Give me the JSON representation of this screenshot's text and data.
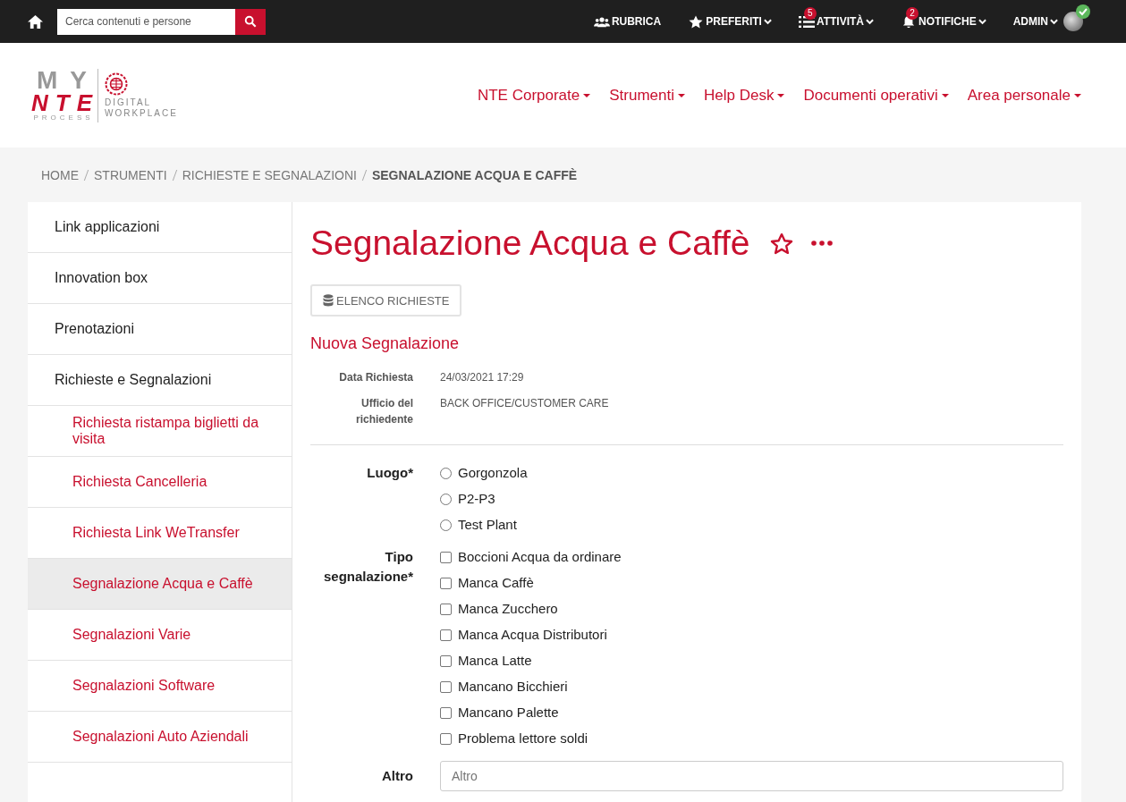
{
  "topbar": {
    "search": {
      "placeholder": "Cerca contenuti e persone"
    },
    "items": [
      {
        "label": "RUBRICA",
        "dropdown": false
      },
      {
        "label": "PREFERITI",
        "dropdown": true
      },
      {
        "label": "ATTIVITÀ",
        "dropdown": true,
        "badge": "5"
      },
      {
        "label": "NOTIFICHE",
        "dropdown": true,
        "badge": "2"
      },
      {
        "label": "ADMIN",
        "dropdown": true
      }
    ],
    "user_online": true
  },
  "logo": {
    "top": "MY",
    "main": "NTE",
    "sub": "PROCESS",
    "tagline_1": "DIGITAL",
    "tagline_2": "WORKPLACE"
  },
  "nav": [
    "NTE Corporate",
    "Strumenti",
    "Help Desk",
    "Documenti operativi",
    "Area personale"
  ],
  "breadcrumb": [
    "HOME",
    "STRUMENTI",
    "RICHIESTE E SEGNALAZIONI",
    "SEGNALAZIONE ACQUA E CAFFÈ"
  ],
  "sidebar": {
    "items": [
      {
        "label": "Link applicazioni",
        "selected": false
      },
      {
        "label": "Innovation box",
        "selected": false
      },
      {
        "label": "Prenotazioni",
        "selected": false
      },
      {
        "label": "Richieste e Segnalazioni",
        "selected": false,
        "children": [
          {
            "label": "Richiesta ristampa biglietti da visita",
            "selected": false
          },
          {
            "label": "Richiesta Cancelleria",
            "selected": false
          },
          {
            "label": "Richiesta Link WeTransfer",
            "selected": false
          },
          {
            "label": "Segnalazione Acqua e Caffè",
            "selected": true
          },
          {
            "label": "Segnalazioni Varie",
            "selected": false
          },
          {
            "label": "Segnalazioni Software",
            "selected": false
          },
          {
            "label": "Segnalazioni Auto Aziendali",
            "selected": false
          }
        ]
      }
    ]
  },
  "page": {
    "title": "Segnalazione Acqua e Caffè",
    "favorite": false,
    "list_button": "ELENCO RICHIESTE",
    "section": "Nuova Segnalazione",
    "info": [
      {
        "label": "Data Richiesta",
        "value": "24/03/2021 17:29"
      },
      {
        "label": "Ufficio del richiedente",
        "value": "BACK OFFICE/CUSTOMER CARE"
      }
    ],
    "fields": [
      {
        "kind": "radio",
        "label": "Luogo*",
        "options": [
          {
            "label": "Gorgonzola",
            "selected": false
          },
          {
            "label": "P2-P3",
            "selected": false
          },
          {
            "label": "Test Plant",
            "selected": false
          }
        ]
      },
      {
        "kind": "checkbox",
        "label": "Tipo segnalazione*",
        "options": [
          {
            "label": "Boccioni Acqua da ordinare",
            "checked": false
          },
          {
            "label": "Manca Caffè",
            "checked": false
          },
          {
            "label": "Manca Zucchero",
            "checked": false
          },
          {
            "label": "Manca Acqua Distributori",
            "checked": false
          },
          {
            "label": "Manca Latte",
            "checked": false
          },
          {
            "label": "Mancano Bicchieri",
            "checked": false
          },
          {
            "label": "Mancano Palette",
            "checked": false
          },
          {
            "label": "Problema lettore soldi",
            "checked": false
          }
        ]
      },
      {
        "kind": "text",
        "label": "Altro",
        "placeholder": "Altro"
      }
    ]
  }
}
